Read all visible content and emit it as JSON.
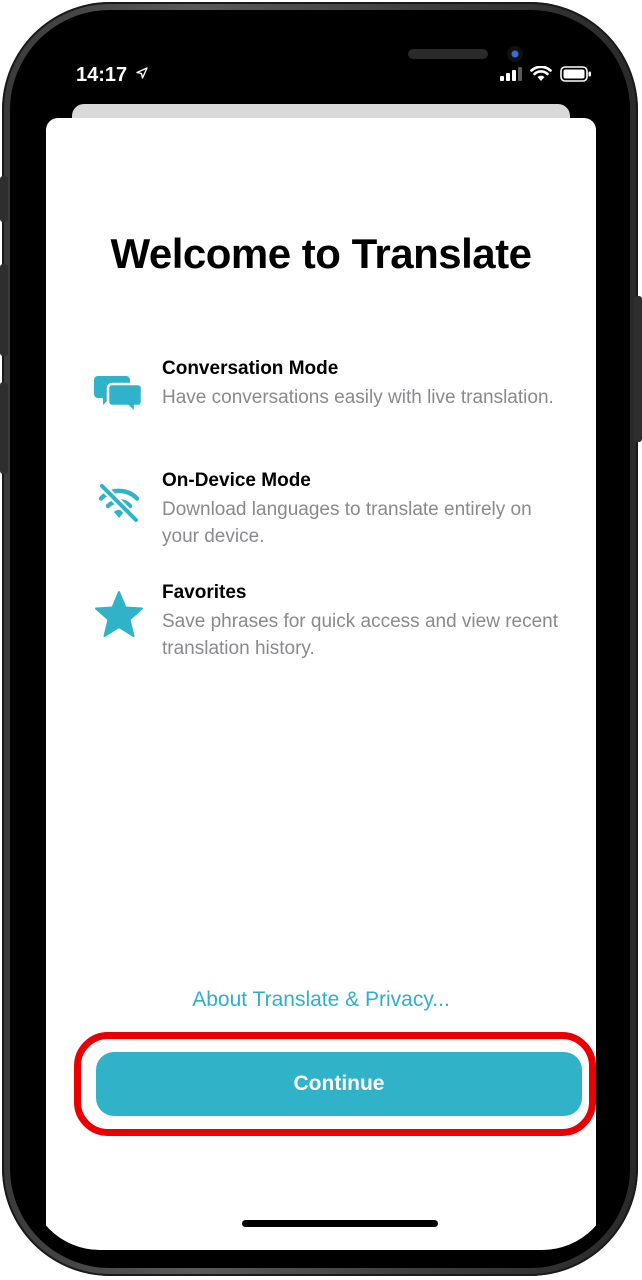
{
  "status_bar": {
    "time": "14:17"
  },
  "welcome": {
    "title": "Welcome to Translate",
    "features": [
      {
        "icon": "conversation-bubbles-icon",
        "title": "Conversation Mode",
        "description": "Have conversations easily with live translation."
      },
      {
        "icon": "wifi-off-icon",
        "title": "On-Device Mode",
        "description": "Download languages to translate entirely on your device."
      },
      {
        "icon": "star-icon",
        "title": "Favorites",
        "description": "Save phrases for quick access and view recent translation history."
      }
    ],
    "privacy_link": "About Translate & Privacy...",
    "continue_label": "Continue"
  },
  "colors": {
    "accent": "#30b2c8",
    "highlight_ring": "#ea0000",
    "secondary_text": "#8a8a8e"
  }
}
